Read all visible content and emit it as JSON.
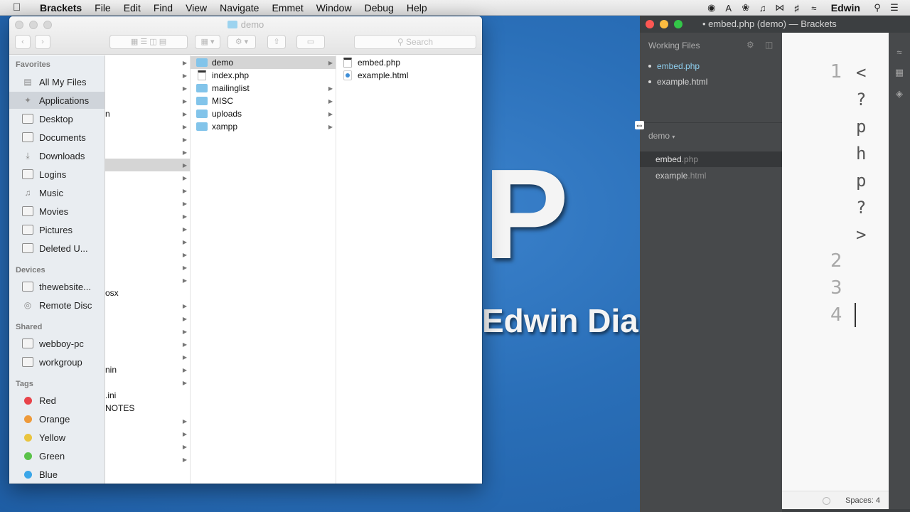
{
  "menubar": {
    "apple": "",
    "app": "Brackets",
    "items": [
      "File",
      "Edit",
      "Find",
      "View",
      "Navigate",
      "Emmet",
      "Window",
      "Debug",
      "Help"
    ],
    "user": "Edwin"
  },
  "wallpaper": {
    "big": "P",
    "name": "Edwin Dia"
  },
  "finder": {
    "title": "demo",
    "search_placeholder": "Search",
    "sidebar": {
      "favorites_label": "Favorites",
      "favorites": [
        "All My Files",
        "Applications",
        "Desktop",
        "Documents",
        "Downloads",
        "Logins",
        "Music",
        "Movies",
        "Pictures",
        "Deleted U..."
      ],
      "devices_label": "Devices",
      "devices": [
        "thewebsite...",
        "Remote Disc"
      ],
      "shared_label": "Shared",
      "shared": [
        "webboy-pc",
        "workgroup"
      ],
      "tags_label": "Tags",
      "tags": [
        {
          "name": "Red",
          "color": "#e8434a"
        },
        {
          "name": "Orange",
          "color": "#ee9a3a"
        },
        {
          "name": "Yellow",
          "color": "#e9c43e"
        },
        {
          "name": "Green",
          "color": "#5ac24a"
        },
        {
          "name": "Blue",
          "color": "#3aa6e8"
        }
      ]
    },
    "col1_fragments": [
      "n",
      "osx",
      "nin",
      ".ini",
      "NOTES"
    ],
    "col2": [
      "demo",
      "index.php",
      "mailinglist",
      "MISC",
      "uploads",
      "xampp"
    ],
    "col3": [
      "embed.php",
      "example.html"
    ]
  },
  "brackets": {
    "title": "embed.php (demo) — Brackets",
    "working_files_label": "Working Files",
    "working_files": [
      "embed.php",
      "example.html"
    ],
    "project": "demo",
    "tree": [
      {
        "name": "embed",
        "ext": ".php"
      },
      {
        "name": "example",
        "ext": ".html"
      }
    ],
    "gutter": [
      "1",
      "2",
      "3",
      "4"
    ],
    "code_chars": [
      "<",
      "?",
      "p",
      "h",
      "p",
      "?",
      ">"
    ],
    "status_spaces": "Spaces: 4",
    "colors": {
      "close": "#fc5753",
      "minimize": "#fdbc40",
      "zoom": "#33c748",
      "active_file": "#8fd0f0"
    }
  }
}
